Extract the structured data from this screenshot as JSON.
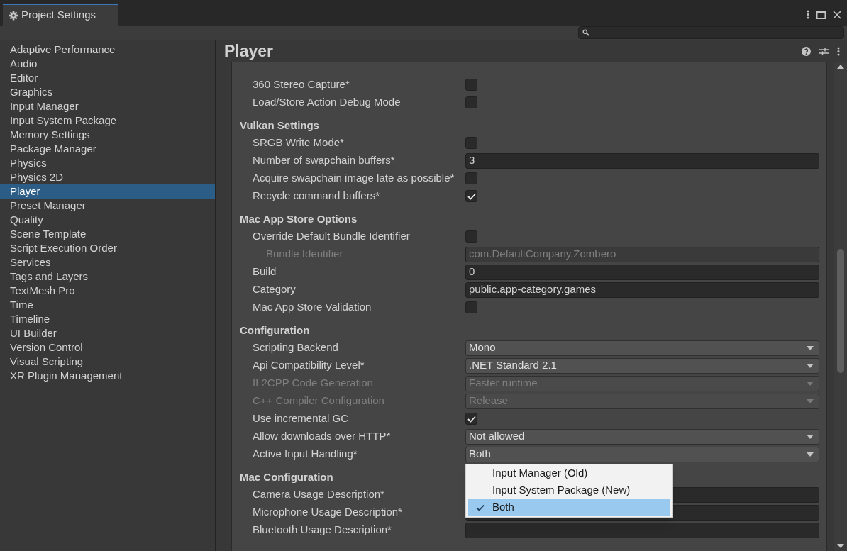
{
  "window": {
    "title": "Project Settings"
  },
  "sidebar": {
    "items": [
      {
        "label": "Adaptive Performance",
        "selected": false
      },
      {
        "label": "Audio",
        "selected": false
      },
      {
        "label": "Editor",
        "selected": false
      },
      {
        "label": "Graphics",
        "selected": false
      },
      {
        "label": "Input Manager",
        "selected": false
      },
      {
        "label": "Input System Package",
        "selected": false
      },
      {
        "label": "Memory Settings",
        "selected": false
      },
      {
        "label": "Package Manager",
        "selected": false
      },
      {
        "label": "Physics",
        "selected": false
      },
      {
        "label": "Physics 2D",
        "selected": false
      },
      {
        "label": "Player",
        "selected": true
      },
      {
        "label": "Preset Manager",
        "selected": false
      },
      {
        "label": "Quality",
        "selected": false
      },
      {
        "label": "Scene Template",
        "selected": false
      },
      {
        "label": "Script Execution Order",
        "selected": false
      },
      {
        "label": "Services",
        "selected": false
      },
      {
        "label": "Tags and Layers",
        "selected": false
      },
      {
        "label": "TextMesh Pro",
        "selected": false
      },
      {
        "label": "Time",
        "selected": false
      },
      {
        "label": "Timeline",
        "selected": false
      },
      {
        "label": "UI Builder",
        "selected": false
      },
      {
        "label": "Version Control",
        "selected": false
      },
      {
        "label": "Visual Scripting",
        "selected": false
      },
      {
        "label": "XR Plugin Management",
        "selected": false
      }
    ]
  },
  "panel": {
    "title": "Player",
    "rows": [
      {
        "kind": "toggle",
        "label": "360 Stereo Capture*",
        "checked": false
      },
      {
        "kind": "toggle",
        "label": "Load/Store Action Debug Mode",
        "checked": false
      },
      {
        "kind": "header",
        "label": "Vulkan Settings"
      },
      {
        "kind": "toggle",
        "label": "SRGB Write Mode*",
        "checked": false
      },
      {
        "kind": "text",
        "label": "Number of swapchain buffers*",
        "value": "3"
      },
      {
        "kind": "toggle",
        "label": "Acquire swapchain image late as possible*",
        "checked": false
      },
      {
        "kind": "toggle",
        "label": "Recycle command buffers*",
        "checked": true
      },
      {
        "kind": "header",
        "label": "Mac App Store Options"
      },
      {
        "kind": "toggle",
        "label": "Override Default Bundle Identifier",
        "checked": false,
        "children": [
          {
            "kind": "text",
            "label": "Bundle Identifier",
            "value": "com.DefaultCompany.Zombero",
            "disabled": true
          }
        ]
      },
      {
        "kind": "text",
        "label": "Build",
        "value": "0"
      },
      {
        "kind": "text",
        "label": "Category",
        "value": "public.app-category.games"
      },
      {
        "kind": "toggle",
        "label": "Mac App Store Validation",
        "checked": false
      },
      {
        "kind": "header",
        "label": "Configuration"
      },
      {
        "kind": "dropdown",
        "label": "Scripting Backend",
        "value": "Mono"
      },
      {
        "kind": "dropdown",
        "label": "Api Compatibility Level*",
        "value": ".NET Standard 2.1"
      },
      {
        "kind": "dropdown",
        "label": "IL2CPP Code Generation",
        "value": "Faster runtime",
        "disabled": true
      },
      {
        "kind": "dropdown",
        "label": "C++ Compiler Configuration",
        "value": "Release",
        "disabled": true
      },
      {
        "kind": "toggle",
        "label": "Use incremental GC",
        "checked": true
      },
      {
        "kind": "dropdown",
        "label": "Allow downloads over HTTP*",
        "value": "Not allowed"
      },
      {
        "kind": "dropdown",
        "label": "Active Input Handling*",
        "value": "Both",
        "popup": {
          "options": [
            {
              "label": "Input Manager (Old)",
              "selected": false
            },
            {
              "label": "Input System Package (New)",
              "selected": false
            },
            {
              "label": "Both",
              "selected": true
            }
          ]
        }
      },
      {
        "kind": "header",
        "label": "Mac Configuration"
      },
      {
        "kind": "text",
        "label": "Camera Usage Description*",
        "value": ""
      },
      {
        "kind": "text",
        "label": "Microphone Usage Description*",
        "value": ""
      },
      {
        "kind": "text",
        "label": "Bluetooth Usage Description*",
        "value": ""
      }
    ]
  }
}
